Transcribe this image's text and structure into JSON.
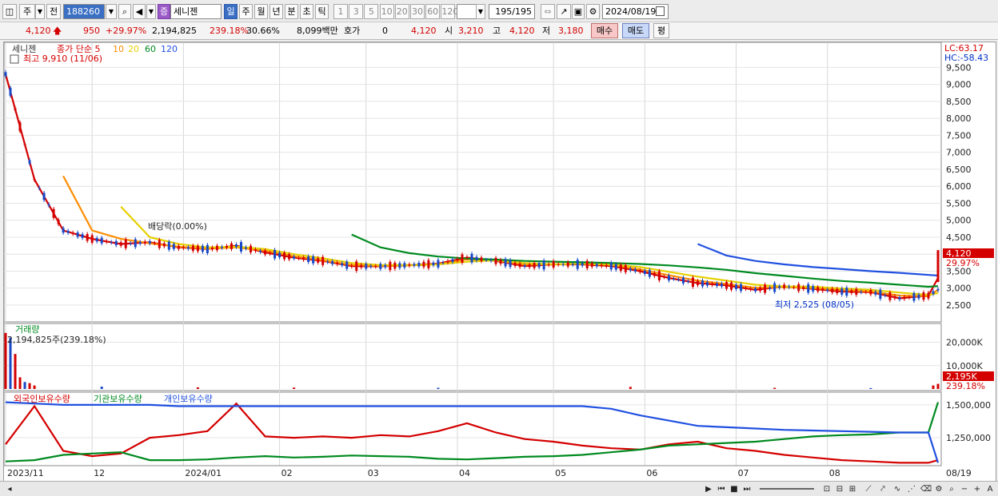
{
  "toolbar": {
    "type_label": "주",
    "prev_label": "전",
    "code": "188260",
    "stock_badge": "증",
    "stock_name": "세니젠",
    "periods": [
      "일",
      "주",
      "월",
      "년",
      "분",
      "초",
      "틱"
    ],
    "active_period": "일",
    "minutes": [
      "1",
      "3",
      "5",
      "10",
      "20",
      "30",
      "60",
      "120"
    ],
    "count": "195/195",
    "date": "2024/08/19"
  },
  "quote": {
    "price": "4,120",
    "change": "950",
    "change_rate": "+29.97%",
    "volume": "2,194,825",
    "volume_ratio": "239.18%",
    "turnover": "30.66%",
    "amount": "8,099백만",
    "hoga_label": "호가",
    "hoga_value": "0",
    "hoga_price": "4,120",
    "open_label": "시",
    "open": "3,210",
    "high_label": "고",
    "high": "4,120",
    "low_label": "저",
    "low": "3,180",
    "buy_label": "매수",
    "sell_label": "매도",
    "eval_label": "평"
  },
  "chart_data": [
    {
      "type": "line",
      "title": "세니젠",
      "legend": [
        "종가 단순 5",
        "10",
        "20",
        "60",
        "120"
      ],
      "legend_colors": [
        "#d40000",
        "#ff8c00",
        "#e6d000",
        "#008a20",
        "#2050e0"
      ],
      "annotations": {
        "high": "최고 9,910 (11/06)",
        "low": "최저 2,525 (08/05)",
        "event": "배당락(0.00%)",
        "lc": "LC:63.17",
        "hc": "HC:-58.43",
        "last_price": "4,120",
        "last_rate": "29.97%"
      },
      "y_ticks": [
        "9,500",
        "9,000",
        "8,500",
        "8,000",
        "7,500",
        "7,000",
        "6,500",
        "6,000",
        "5,500",
        "5,000",
        "4,500",
        "4,000",
        "3,500",
        "3,000",
        "2,500"
      ],
      "ylim": [
        2100,
        10050
      ],
      "x": [
        0,
        6,
        12,
        18,
        24,
        30,
        36,
        42,
        48,
        54,
        60,
        66,
        72,
        78,
        84,
        90,
        96,
        102,
        108,
        114,
        120,
        126,
        132,
        138,
        144,
        150,
        156,
        162,
        168,
        174,
        180,
        186,
        192,
        194
      ],
      "series": [
        {
          "name": "5",
          "color": "#d40000",
          "values": [
            9300,
            6200,
            4700,
            4450,
            4300,
            4350,
            4200,
            4150,
            4250,
            4050,
            3900,
            3800,
            3650,
            3640,
            3680,
            3720,
            3900,
            3800,
            3650,
            3700,
            3700,
            3650,
            3500,
            3300,
            3150,
            3080,
            2950,
            3050,
            2980,
            2900,
            2880,
            2700,
            2780,
            3300
          ]
        },
        {
          "name": "10",
          "color": "#ff8c00",
          "values": [
            null,
            null,
            6300,
            4700,
            4450,
            4320,
            4220,
            4160,
            4200,
            4100,
            3940,
            3820,
            3680,
            3650,
            3670,
            3700,
            3850,
            3820,
            3690,
            3700,
            3720,
            3680,
            3550,
            3380,
            3220,
            3120,
            3010,
            3030,
            3000,
            2940,
            2900,
            2780,
            2760,
            2950
          ]
        },
        {
          "name": "20",
          "color": "#e6d000",
          "values": [
            null,
            null,
            null,
            null,
            5400,
            4500,
            4300,
            4200,
            4220,
            4150,
            4000,
            3880,
            3740,
            3680,
            3680,
            3700,
            3780,
            3820,
            3740,
            3700,
            3720,
            3700,
            3620,
            3480,
            3340,
            3220,
            3100,
            3050,
            3040,
            2990,
            2950,
            2870,
            2800,
            2850
          ]
        },
        {
          "name": "60",
          "color": "#008a20",
          "values": [
            null,
            null,
            null,
            null,
            null,
            null,
            null,
            null,
            null,
            null,
            null,
            null,
            4580,
            4200,
            4030,
            3930,
            3870,
            3840,
            3800,
            3780,
            3760,
            3740,
            3710,
            3670,
            3610,
            3540,
            3440,
            3360,
            3280,
            3210,
            3160,
            3100,
            3040,
            3060
          ]
        },
        {
          "name": "120",
          "color": "#2050e0",
          "values": [
            null,
            null,
            null,
            null,
            null,
            null,
            null,
            null,
            null,
            null,
            null,
            null,
            null,
            null,
            null,
            null,
            null,
            null,
            null,
            null,
            null,
            null,
            null,
            null,
            4300,
            3960,
            3800,
            3700,
            3620,
            3560,
            3500,
            3450,
            3390,
            3370
          ]
        }
      ]
    },
    {
      "type": "bar",
      "title": "거래량",
      "annotation": "2,194,825주(239.18%)",
      "y_ticks": [
        "20,000K",
        "10,000K"
      ],
      "last_value": "2,195K",
      "last_rate": "239.18%",
      "ylim": [
        0,
        26000
      ],
      "x": [
        0,
        1,
        2,
        3,
        4,
        5,
        6,
        20,
        40,
        60,
        90,
        130,
        160,
        180,
        193,
        194
      ],
      "values": [
        24000,
        22000,
        15000,
        5000,
        3000,
        2500,
        1500,
        1000,
        700,
        600,
        500,
        900,
        500,
        400,
        1500,
        2195
      ]
    },
    {
      "type": "line",
      "legend": [
        "외국인보유수량",
        "기관보유수량",
        "개인보유수량"
      ],
      "legend_colors": [
        "#d40000",
        "#008a20",
        "#2050e0"
      ],
      "y_ticks": [
        "1,500,000",
        "1,250,000"
      ],
      "ylim": [
        1050000,
        1560000
      ],
      "x": [
        0,
        6,
        12,
        18,
        24,
        30,
        36,
        42,
        48,
        54,
        60,
        66,
        72,
        78,
        84,
        90,
        96,
        102,
        108,
        114,
        120,
        126,
        132,
        138,
        144,
        150,
        156,
        162,
        168,
        174,
        180,
        186,
        192,
        194
      ],
      "series": [
        {
          "name": "외국인보유수량",
          "color": "#d40000",
          "values": [
            1200000,
            1490000,
            1150000,
            1110000,
            1130000,
            1250000,
            1270000,
            1300000,
            1510000,
            1260000,
            1250000,
            1260000,
            1250000,
            1270000,
            1260000,
            1300000,
            1360000,
            1290000,
            1240000,
            1220000,
            1190000,
            1170000,
            1160000,
            1200000,
            1220000,
            1170000,
            1150000,
            1120000,
            1100000,
            1080000,
            1070000,
            1060000,
            1060000,
            1080000
          ]
        },
        {
          "name": "기관보유수량",
          "color": "#008a20",
          "values": [
            1070000,
            1080000,
            1120000,
            1130000,
            1140000,
            1080000,
            1080000,
            1085000,
            1100000,
            1110000,
            1100000,
            1105000,
            1115000,
            1110000,
            1105000,
            1090000,
            1085000,
            1095000,
            1105000,
            1110000,
            1120000,
            1140000,
            1160000,
            1190000,
            1200000,
            1210000,
            1220000,
            1240000,
            1260000,
            1270000,
            1275000,
            1290000,
            1290000,
            1520000
          ]
        },
        {
          "name": "개인보유수량",
          "color": "#2050e0",
          "values": [
            1520000,
            1510000,
            1500000,
            1500000,
            1500000,
            1500000,
            1490000,
            1490000,
            1490000,
            1490000,
            1490000,
            1490000,
            1490000,
            1490000,
            1490000,
            1490000,
            1490000,
            1490000,
            1490000,
            1490000,
            1490000,
            1470000,
            1420000,
            1380000,
            1340000,
            1330000,
            1320000,
            1310000,
            1305000,
            1300000,
            1295000,
            1290000,
            1290000,
            1060000
          ]
        }
      ]
    }
  ],
  "x_axis": {
    "ticks": [
      "2023/11",
      "12",
      "2024/01",
      "02",
      "03",
      "04",
      "05",
      "06",
      "07",
      "08"
    ],
    "tick_index": [
      0,
      18,
      37,
      57,
      75,
      94,
      114,
      133,
      152,
      171
    ],
    "last": "08/19"
  },
  "status": {
    "buttons": [
      "▶",
      "⏮",
      "■",
      "⏭"
    ]
  }
}
